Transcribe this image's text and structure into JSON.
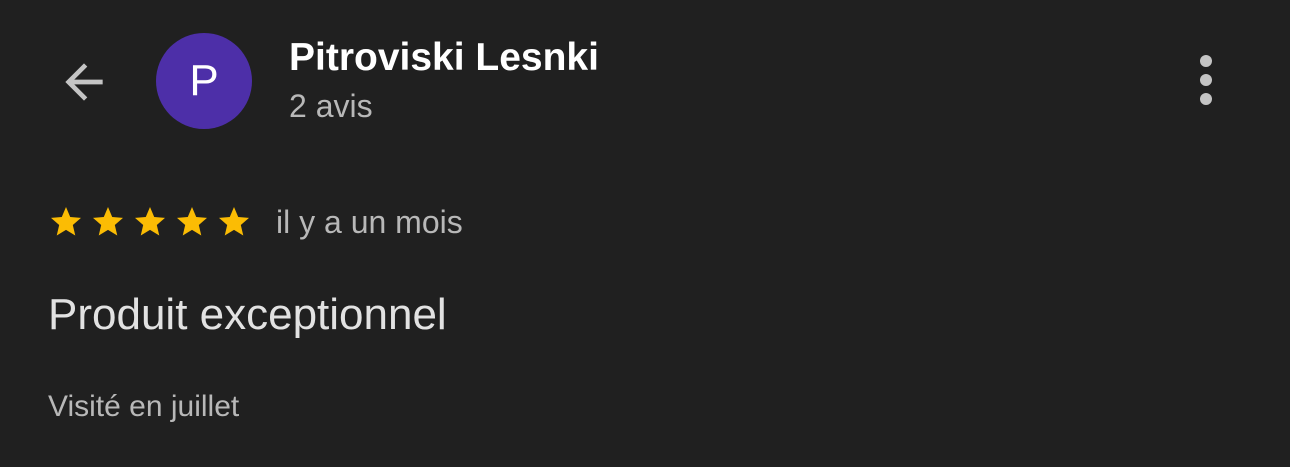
{
  "header": {
    "author_name": "Pitroviski Lesnki",
    "avatar_initial": "P",
    "review_count": "2 avis"
  },
  "review": {
    "rating": 5,
    "rating_max": 5,
    "time_ago": "il y a un mois",
    "text": "Produit exceptionnel",
    "visit": "Visité en juillet"
  },
  "icons": {
    "back": "arrow-back-icon",
    "more": "more-vert-icon",
    "star": "star-icon"
  },
  "colors": {
    "background": "#202020",
    "avatar": "#4d2fa8",
    "star": "#fbbc04",
    "icon": "#c4c4c4"
  }
}
